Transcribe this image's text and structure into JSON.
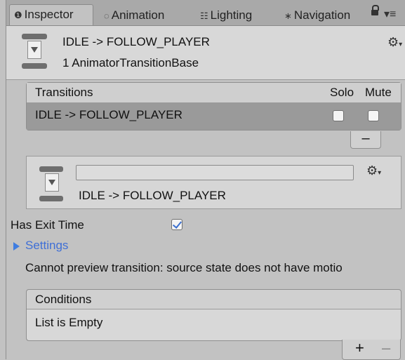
{
  "tabs": [
    {
      "label": "Inspector",
      "icon": "info-icon"
    },
    {
      "label": "Animation",
      "icon": "animation-icon"
    },
    {
      "label": "Lighting",
      "icon": "lighting-icon"
    },
    {
      "label": "Navigation",
      "icon": "navigation-icon"
    }
  ],
  "header": {
    "title": "IDLE -> FOLLOW_PLAYER",
    "subtitle": "1 AnimatorTransitionBase"
  },
  "transitions_list": {
    "header_label": "Transitions",
    "solo_label": "Solo",
    "mute_label": "Mute",
    "rows": [
      {
        "label": "IDLE -> FOLLOW_PLAYER",
        "solo": false,
        "mute": false
      }
    ],
    "remove_label": "–"
  },
  "editor": {
    "name_value": "",
    "label": "IDLE -> FOLLOW_PLAYER"
  },
  "has_exit_time": {
    "label": "Has Exit Time",
    "checked": true
  },
  "settings_label": "Settings",
  "preview_message": "Cannot preview transition: source state does not have motio",
  "conditions": {
    "header_label": "Conditions",
    "empty_text": "List is Empty",
    "add_label": "+",
    "remove_label": "–"
  },
  "colors": {
    "accent": "#3f6fd6",
    "panel": "#c2c2c2"
  }
}
